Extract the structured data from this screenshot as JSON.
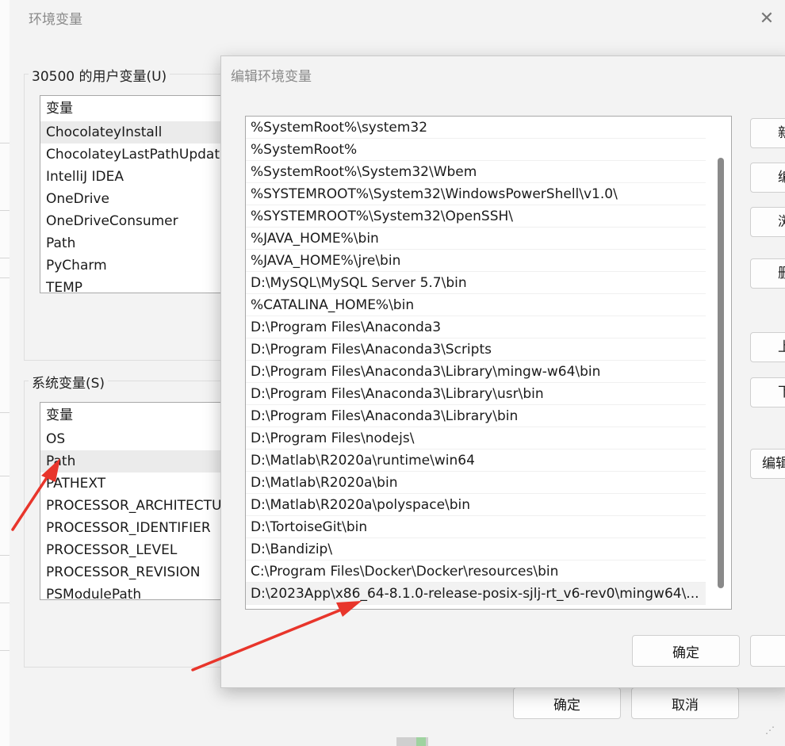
{
  "env_dialog": {
    "title": "环境变量",
    "close_glyph": "✕",
    "user_vars": {
      "label": "30500 的用户变量(U)",
      "header": "变量",
      "items": [
        "ChocolateyInstall",
        "ChocolateyLastPathUpdat",
        "IntelliJ IDEA",
        "OneDrive",
        "OneDriveConsumer",
        "Path",
        "PyCharm",
        "TEMP"
      ],
      "selected": "ChocolateyInstall"
    },
    "system_vars": {
      "label": "系统变量(S)",
      "header": "变量",
      "items": [
        "OS",
        "Path",
        "PATHEXT",
        "PROCESSOR_ARCHITECTU",
        "PROCESSOR_IDENTIFIER",
        "PROCESSOR_LEVEL",
        "PROCESSOR_REVISION",
        "PSModulePath"
      ],
      "selected": "Path"
    },
    "ok_label": "确定",
    "cancel_label": "取消"
  },
  "edit_dialog": {
    "title": "编辑环境变量",
    "paths": [
      "%SystemRoot%\\system32",
      "%SystemRoot%",
      "%SystemRoot%\\System32\\Wbem",
      "%SYSTEMROOT%\\System32\\WindowsPowerShell\\v1.0\\",
      "%SYSTEMROOT%\\System32\\OpenSSH\\",
      "%JAVA_HOME%\\bin",
      "%JAVA_HOME%\\jre\\bin",
      "D:\\MySQL\\MySQL Server 5.7\\bin",
      "%CATALINA_HOME%\\bin",
      "D:\\Program Files\\Anaconda3",
      "D:\\Program Files\\Anaconda3\\Scripts",
      "D:\\Program Files\\Anaconda3\\Library\\mingw-w64\\bin",
      "D:\\Program Files\\Anaconda3\\Library\\usr\\bin",
      "D:\\Program Files\\Anaconda3\\Library\\bin",
      "D:\\Program Files\\nodejs\\",
      "D:\\Matlab\\R2020a\\runtime\\win64",
      "D:\\Matlab\\R2020a\\bin",
      "D:\\Matlab\\R2020a\\polyspace\\bin",
      "D:\\TortoiseGit\\bin",
      "D:\\Bandizip\\",
      "C:\\Program Files\\Docker\\Docker\\resources\\bin",
      "D:\\2023App\\x86_64-8.1.0-release-posix-sjlj-rt_v6-rev0\\mingw64\\..."
    ],
    "selected_index": 21,
    "side_buttons": [
      "新",
      "编",
      "浏",
      "删",
      "上",
      "下",
      "编辑"
    ],
    "ok_label": "确定"
  },
  "colors": {
    "annotation_arrow": "#e8352b",
    "dialog_bg": "#f3f3f3"
  }
}
